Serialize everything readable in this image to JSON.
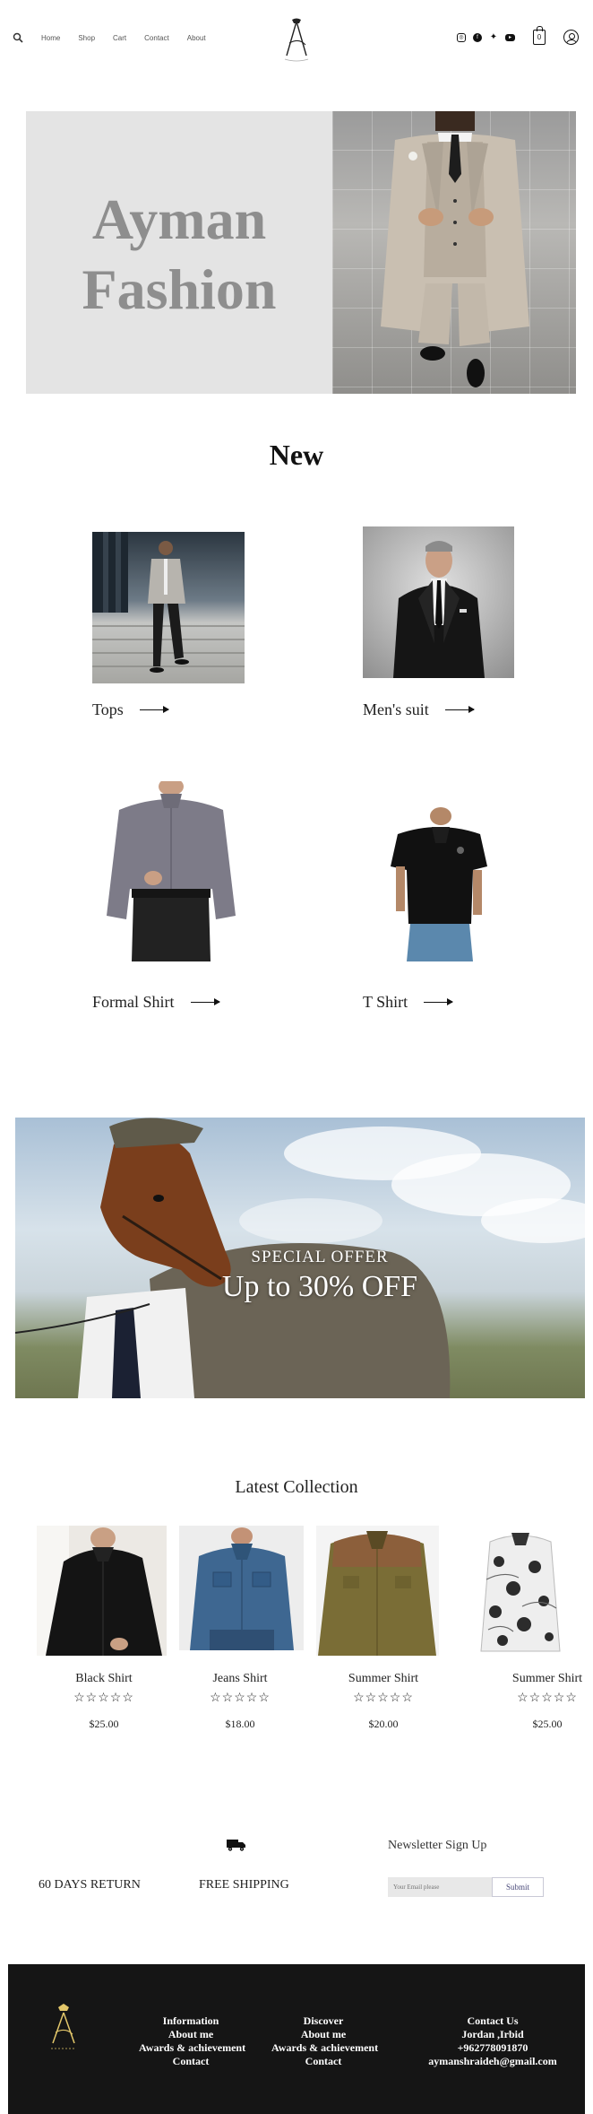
{
  "header": {
    "nav": [
      "Home",
      "Shop",
      "Cart",
      "Contact",
      "About"
    ],
    "social_icons": [
      "instagram-icon",
      "facebook-icon",
      "twitter-icon",
      "youtube-icon"
    ],
    "cart_count": "0"
  },
  "hero": {
    "title_line1": "Ayman",
    "title_line2": "Fashion"
  },
  "new_section": {
    "title": "New",
    "categories": [
      {
        "label": "Tops"
      },
      {
        "label": "Men's suit"
      },
      {
        "label": "Formal Shirt"
      },
      {
        "label": "T Shirt"
      }
    ]
  },
  "offer": {
    "subtitle": "SPECIAL OFFER",
    "headline": "Up to 30% OFF"
  },
  "latest": {
    "title": "Latest Collection",
    "products": [
      {
        "name": "Black Shirt",
        "price": "$25.00",
        "rating": "☆☆☆☆☆"
      },
      {
        "name": "Jeans Shirt",
        "price": "$18.00",
        "rating": "☆☆☆☆☆"
      },
      {
        "name": "Summer Shirt",
        "price": "$20.00",
        "rating": "☆☆☆☆☆"
      },
      {
        "name": "Summer Shirt",
        "price": "$25.00",
        "rating": "☆☆☆☆☆"
      }
    ]
  },
  "services": {
    "returns": "60 DAYS RETURN",
    "shipping": "FREE SHIPPING"
  },
  "newsletter": {
    "title": "Newsletter Sign Up",
    "placeholder": "Your Email please",
    "submit": "Submit"
  },
  "footer": {
    "information": [
      "Information",
      "About me",
      "Awards & achievement",
      "Contact"
    ],
    "discover": [
      "Discover",
      "About me",
      "Awards & achievement",
      "Contact"
    ],
    "contact": [
      "Contact Us",
      "Jordan ,Irbid",
      "+962778091870",
      "aymanshraideh@gmail.com"
    ]
  },
  "colors": {
    "hero_panel": "#e4e4e4",
    "hero_text": "#8e8e8e",
    "footer_bg": "#151515"
  }
}
